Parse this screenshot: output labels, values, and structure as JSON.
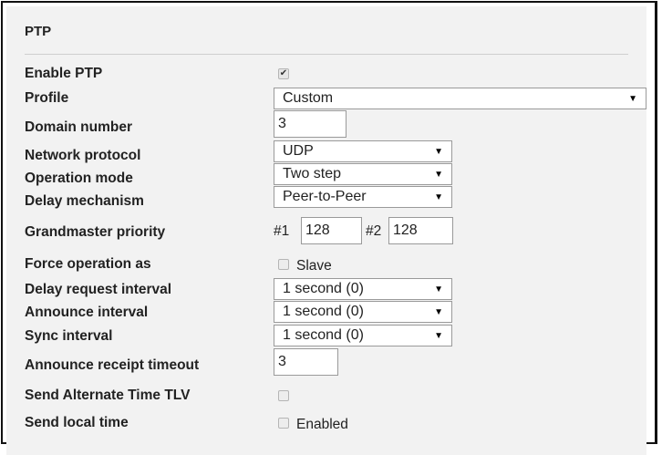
{
  "panel": {
    "title": "PTP"
  },
  "fields": {
    "enable_ptp": {
      "label": "Enable PTP",
      "checked": true
    },
    "profile": {
      "label": "Profile",
      "value": "Custom"
    },
    "domain_number": {
      "label": "Domain number",
      "value": "3"
    },
    "network_protocol": {
      "label": "Network protocol",
      "value": "UDP"
    },
    "operation_mode": {
      "label": "Operation mode",
      "value": "Two step"
    },
    "delay_mechanism": {
      "label": "Delay mechanism",
      "value": "Peer-to-Peer"
    },
    "grandmaster_priority": {
      "label": "Grandmaster priority",
      "p1_prefix": "#1",
      "p1_value": "128",
      "p2_prefix": "#2",
      "p2_value": "128"
    },
    "force_operation_as": {
      "label": "Force operation as",
      "option_label": "Slave",
      "checked": false
    },
    "delay_request_interval": {
      "label": "Delay request interval",
      "value": "1 second (0)"
    },
    "announce_interval": {
      "label": "Announce interval",
      "value": "1 second (0)"
    },
    "sync_interval": {
      "label": "Sync interval",
      "value": "1 second (0)"
    },
    "announce_receipt_timeout": {
      "label": "Announce receipt timeout",
      "value": "3"
    },
    "send_alternate_time_tlv": {
      "label": "Send Alternate Time TLV",
      "checked": false
    },
    "send_local_time": {
      "label": "Send local time",
      "option_label": "Enabled",
      "checked": false
    }
  },
  "icons": {
    "checkmark": "✔",
    "dropdown_arrow": "▼"
  }
}
